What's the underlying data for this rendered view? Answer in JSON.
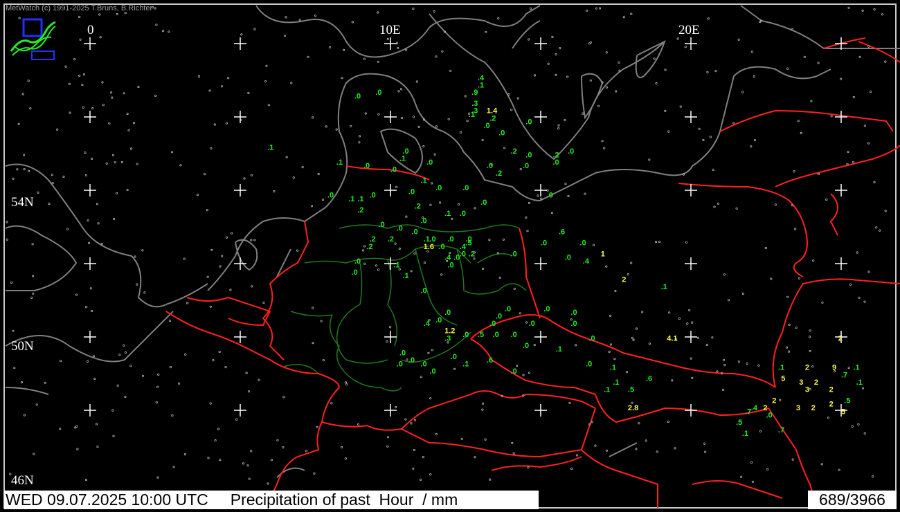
{
  "app": {
    "credit": "MetWatch  (c) 1991-2025 T.Bruns, B.Richter",
    "datetime": "WED 09.07.2025 10:00 UTC",
    "product": "Precipitation of past  Hour  / mm",
    "station_count": "689/3966"
  },
  "icons": {
    "logo": "metwatch-logo-icon"
  },
  "colors": {
    "background": "#000000",
    "coastline": "#808080",
    "country_border": "#ff2020",
    "state_border": "#1f7a1f",
    "value_low": "#22ee22",
    "value_high": "#ffff44",
    "graticule": "#ffffff"
  },
  "graticule": {
    "lon_labels": [
      "0",
      "10E",
      "20E"
    ],
    "lat_labels": [
      "54N",
      "50N",
      "46N"
    ]
  },
  "precip_values": [
    {
      "lon": 12.9,
      "lat": 55.0,
      "v": ".4"
    },
    {
      "lon": 12.9,
      "lat": 54.8,
      "v": ".1"
    },
    {
      "lon": 12.7,
      "lat": 54.6,
      "v": ".9"
    },
    {
      "lon": 12.7,
      "lat": 54.3,
      "v": ".3"
    },
    {
      "lon": 12.7,
      "lat": 54.1,
      "v": ".3"
    },
    {
      "lon": 13.2,
      "lat": 54.1,
      "v": "1.4",
      "hi": true
    },
    {
      "lon": 12.6,
      "lat": 54.0,
      "v": ".1"
    },
    {
      "lon": 13.3,
      "lat": 53.9,
      "v": ".2"
    },
    {
      "lon": 8.8,
      "lat": 54.5,
      "v": ".0"
    },
    {
      "lon": 9.5,
      "lat": 54.6,
      "v": ".0"
    },
    {
      "lon": 14.5,
      "lat": 53.8,
      "v": ".0"
    },
    {
      "lon": 13.1,
      "lat": 53.7,
      "v": ".0"
    },
    {
      "lon": 13.6,
      "lat": 53.5,
      "v": ".0"
    },
    {
      "lon": 5.9,
      "lat": 53.1,
      "v": ".1"
    },
    {
      "lon": 10.4,
      "lat": 53.0,
      "v": ".0"
    },
    {
      "lon": 10.3,
      "lat": 52.8,
      "v": ".1"
    },
    {
      "lon": 14.0,
      "lat": 53.0,
      "v": ".2"
    },
    {
      "lon": 14.5,
      "lat": 52.9,
      "v": ".0"
    },
    {
      "lon": 15.4,
      "lat": 52.9,
      "v": ".2"
    },
    {
      "lon": 15.9,
      "lat": 53.0,
      "v": ".0"
    },
    {
      "lon": 15.4,
      "lat": 52.7,
      "v": ".0"
    },
    {
      "lon": 8.2,
      "lat": 52.7,
      "v": ".1"
    },
    {
      "lon": 9.1,
      "lat": 52.6,
      "v": ".0"
    },
    {
      "lon": 10.0,
      "lat": 52.5,
      "v": ".0"
    },
    {
      "lon": 11.2,
      "lat": 52.7,
      "v": ".0"
    },
    {
      "lon": 11.0,
      "lat": 52.2,
      "v": ".1"
    },
    {
      "lon": 11.5,
      "lat": 52.0,
      "v": ".0"
    },
    {
      "lon": 12.4,
      "lat": 52.0,
      "v": ".0"
    },
    {
      "lon": 13.2,
      "lat": 52.6,
      "v": ".0"
    },
    {
      "lon": 13.5,
      "lat": 52.4,
      "v": ".2"
    },
    {
      "lon": 14.4,
      "lat": 52.6,
      "v": ".0"
    },
    {
      "lon": 10.6,
      "lat": 51.9,
      "v": ".0"
    },
    {
      "lon": 10.8,
      "lat": 51.5,
      "v": ".2"
    },
    {
      "lon": 7.9,
      "lat": 51.8,
      "v": ".0"
    },
    {
      "lon": 8.6,
      "lat": 51.7,
      "v": ".1"
    },
    {
      "lon": 8.9,
      "lat": 51.7,
      "v": ".1"
    },
    {
      "lon": 9.3,
      "lat": 51.8,
      "v": ".0"
    },
    {
      "lon": 8.9,
      "lat": 51.4,
      "v": ".2"
    },
    {
      "lon": 13.0,
      "lat": 51.6,
      "v": ".0"
    },
    {
      "lon": 15.2,
      "lat": 51.8,
      "v": ".0"
    },
    {
      "lon": 11.8,
      "lat": 51.3,
      "v": ".1"
    },
    {
      "lon": 11.0,
      "lat": 51.1,
      "v": ".0"
    },
    {
      "lon": 12.3,
      "lat": 51.3,
      "v": ".0"
    },
    {
      "lon": 9.6,
      "lat": 51.0,
      "v": ".0"
    },
    {
      "lon": 10.2,
      "lat": 50.9,
      "v": ".0"
    },
    {
      "lon": 10.7,
      "lat": 50.8,
      "v": ".0"
    },
    {
      "lon": 9.3,
      "lat": 50.6,
      "v": ".2"
    },
    {
      "lon": 9.9,
      "lat": 50.6,
      "v": ".2"
    },
    {
      "lon": 9.2,
      "lat": 50.4,
      "v": ".2"
    },
    {
      "lon": 11.1,
      "lat": 50.6,
      "v": ".1"
    },
    {
      "lon": 11.3,
      "lat": 50.6,
      "v": ".0"
    },
    {
      "lon": 11.1,
      "lat": 50.4,
      "v": "1.6",
      "hi": true
    },
    {
      "lon": 11.6,
      "lat": 50.4,
      "v": ".0"
    },
    {
      "lon": 11.9,
      "lat": 50.6,
      "v": ".0"
    },
    {
      "lon": 12.3,
      "lat": 50.4,
      "v": ".4"
    },
    {
      "lon": 12.5,
      "lat": 50.6,
      "v": ".0"
    },
    {
      "lon": 12.5,
      "lat": 50.5,
      "v": ".5"
    },
    {
      "lon": 12.1,
      "lat": 50.1,
      "v": ".0"
    },
    {
      "lon": 12.6,
      "lat": 50.2,
      "v": ".2"
    },
    {
      "lon": 12.3,
      "lat": 50.2,
      "v": ".0"
    },
    {
      "lon": 11.8,
      "lat": 50.1,
      "v": ".4"
    },
    {
      "lon": 11.9,
      "lat": 49.9,
      "v": ".0"
    },
    {
      "lon": 8.8,
      "lat": 50.0,
      "v": ".0"
    },
    {
      "lon": 8.7,
      "lat": 49.7,
      "v": ".0"
    },
    {
      "lon": 10.1,
      "lat": 49.9,
      "v": ".1"
    },
    {
      "lon": 10.4,
      "lat": 49.6,
      "v": ".1"
    },
    {
      "lon": 11.0,
      "lat": 49.2,
      "v": ".0"
    },
    {
      "lon": 14.0,
      "lat": 50.2,
      "v": ".0"
    },
    {
      "lon": 15.0,
      "lat": 50.5,
      "v": ".0"
    },
    {
      "lon": 15.6,
      "lat": 50.8,
      "v": ".6"
    },
    {
      "lon": 16.3,
      "lat": 50.5,
      "v": ".0"
    },
    {
      "lon": 15.8,
      "lat": 50.1,
      "v": ".0"
    },
    {
      "lon": 16.4,
      "lat": 50.0,
      "v": ".4"
    },
    {
      "lon": 17.0,
      "lat": 50.2,
      "v": "1",
      "hi": true
    },
    {
      "lon": 17.7,
      "lat": 49.5,
      "v": "2",
      "hi": true
    },
    {
      "lon": 19.0,
      "lat": 49.3,
      "v": ".1"
    },
    {
      "lon": 11.8,
      "lat": 48.6,
      "v": ".0"
    },
    {
      "lon": 11.5,
      "lat": 48.4,
      "v": ".0"
    },
    {
      "lon": 11.1,
      "lat": 48.3,
      "v": ".4"
    },
    {
      "lon": 11.8,
      "lat": 48.1,
      "v": "1.2",
      "hi": true
    },
    {
      "lon": 11.8,
      "lat": 47.9,
      "v": ".3"
    },
    {
      "lon": 12.4,
      "lat": 48.0,
      "v": ".0"
    },
    {
      "lon": 12.9,
      "lat": 48.0,
      "v": ".5"
    },
    {
      "lon": 13.3,
      "lat": 48.3,
      "v": ".0"
    },
    {
      "lon": 13.5,
      "lat": 48.5,
      "v": ".0"
    },
    {
      "lon": 13.8,
      "lat": 48.7,
      "v": ".0"
    },
    {
      "lon": 13.4,
      "lat": 48.0,
      "v": ".0"
    },
    {
      "lon": 14.0,
      "lat": 48.0,
      "v": ".0"
    },
    {
      "lon": 14.6,
      "lat": 48.3,
      "v": ".0"
    },
    {
      "lon": 15.1,
      "lat": 48.7,
      "v": ".0"
    },
    {
      "lon": 16.0,
      "lat": 48.6,
      "v": ".0"
    },
    {
      "lon": 16.0,
      "lat": 48.3,
      "v": ".0"
    },
    {
      "lon": 16.6,
      "lat": 47.9,
      "v": ".0"
    },
    {
      "lon": 14.4,
      "lat": 47.7,
      "v": ".0"
    },
    {
      "lon": 15.5,
      "lat": 47.6,
      "v": ".1"
    },
    {
      "lon": 16.5,
      "lat": 47.2,
      "v": ".0"
    },
    {
      "lon": 19.2,
      "lat": 47.9,
      "v": "4.1",
      "hi": true
    },
    {
      "lon": 13.2,
      "lat": 47.3,
      "v": ".6"
    },
    {
      "lon": 14.0,
      "lat": 47.0,
      "v": ".0"
    },
    {
      "lon": 12.0,
      "lat": 47.4,
      "v": ".0"
    },
    {
      "lon": 12.4,
      "lat": 47.2,
      "v": ".1"
    },
    {
      "lon": 11.0,
      "lat": 47.2,
      "v": ".0"
    },
    {
      "lon": 10.3,
      "lat": 47.5,
      "v": ".0"
    },
    {
      "lon": 10.6,
      "lat": 47.3,
      "v": ".0"
    },
    {
      "lon": 10.2,
      "lat": 47.2,
      "v": ".0"
    },
    {
      "lon": 11.3,
      "lat": 47.0,
      "v": ".0"
    },
    {
      "lon": 17.3,
      "lat": 47.1,
      "v": ".1"
    },
    {
      "lon": 18.5,
      "lat": 46.8,
      "v": ".6"
    },
    {
      "lon": 17.4,
      "lat": 46.7,
      "v": ".1"
    },
    {
      "lon": 17.1,
      "lat": 46.5,
      "v": ".1"
    },
    {
      "lon": 17.9,
      "lat": 46.5,
      "v": ".5"
    },
    {
      "lon": 17.9,
      "lat": 46.0,
      "v": "2.8",
      "hi": true
    },
    {
      "lon": 22.9,
      "lat": 47.1,
      "v": ".1"
    },
    {
      "lon": 23.8,
      "lat": 47.1,
      "v": "2",
      "hi": true
    },
    {
      "lon": 24.7,
      "lat": 47.1,
      "v": "9",
      "hi": true
    },
    {
      "lon": 25.4,
      "lat": 47.1,
      "v": ".1"
    },
    {
      "lon": 24.9,
      "lat": 47.9,
      "v": "2",
      "hi": true
    },
    {
      "lon": 23.0,
      "lat": 46.8,
      "v": "5",
      "hi": true
    },
    {
      "lon": 23.6,
      "lat": 46.7,
      "v": "3",
      "hi": true
    },
    {
      "lon": 24.1,
      "lat": 46.7,
      "v": "2",
      "hi": true
    },
    {
      "lon": 23.8,
      "lat": 46.5,
      "v": "3",
      "hi": true
    },
    {
      "lon": 24.6,
      "lat": 46.5,
      "v": "2",
      "hi": true
    },
    {
      "lon": 25.0,
      "lat": 46.9,
      "v": ".7"
    },
    {
      "lon": 25.5,
      "lat": 46.7,
      "v": ".1"
    },
    {
      "lon": 22.7,
      "lat": 46.2,
      "v": "2",
      "hi": true
    },
    {
      "lon": 22.0,
      "lat": 46.0,
      "v": ".4"
    },
    {
      "lon": 21.8,
      "lat": 45.9,
      "v": ".7"
    },
    {
      "lon": 22.4,
      "lat": 46.0,
      "v": "2",
      "hi": true
    },
    {
      "lon": 23.5,
      "lat": 46.0,
      "v": "3",
      "hi": true
    },
    {
      "lon": 24.0,
      "lat": 46.0,
      "v": "2",
      "hi": true
    },
    {
      "lon": 24.6,
      "lat": 46.1,
      "v": "2",
      "hi": true
    },
    {
      "lon": 25.1,
      "lat": 46.2,
      "v": ".5"
    },
    {
      "lon": 22.5,
      "lat": 45.8,
      "v": ".0"
    },
    {
      "lon": 21.5,
      "lat": 45.6,
      "v": ".5"
    },
    {
      "lon": 25.0,
      "lat": 45.9,
      "v": "5",
      "hi": true
    },
    {
      "lon": 22.9,
      "lat": 45.4,
      "v": ".7"
    },
    {
      "lon": 21.7,
      "lat": 45.3,
      "v": ".1"
    }
  ]
}
